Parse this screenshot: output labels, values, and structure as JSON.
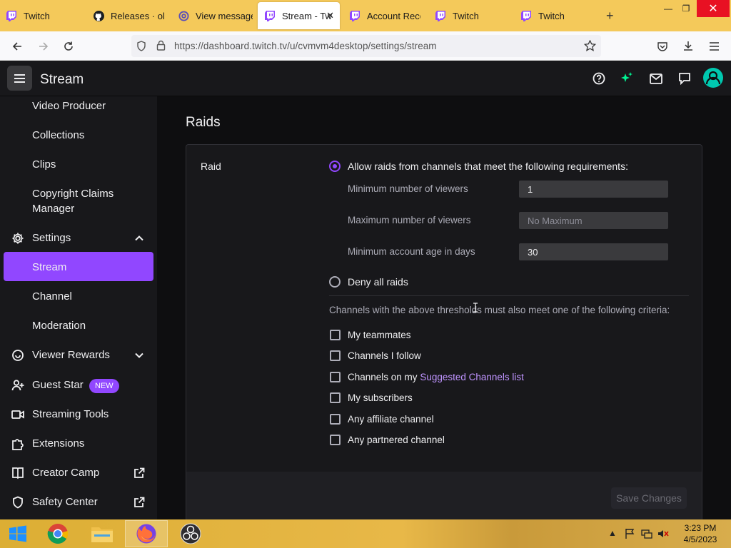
{
  "browser": {
    "tabs": [
      {
        "label": "Twitch",
        "icon": "twitch-icon"
      },
      {
        "label": "Releases · obsp",
        "icon": "github-icon"
      },
      {
        "label": "View message",
        "icon": "at-sign-icon"
      },
      {
        "label": "Stream - Tw",
        "icon": "twitch-icon",
        "active": true
      },
      {
        "label": "Account Reco",
        "icon": "twitch-icon"
      },
      {
        "label": "Twitch",
        "icon": "twitch-icon"
      },
      {
        "label": "Twitch",
        "icon": "twitch-icon"
      }
    ],
    "new_tab": "+",
    "url": "https://dashboard.twitch.tv/u/cvmvm4desktop/settings/stream"
  },
  "header": {
    "title": "Stream"
  },
  "sidebar": {
    "items": [
      {
        "label": "Video Producer"
      },
      {
        "label": "Collections"
      },
      {
        "label": "Clips"
      },
      {
        "label": "Copyright Claims Manager",
        "line1": "Copyright Claims",
        "line2": "Manager"
      },
      {
        "label": "Settings",
        "icon": "gear-icon"
      },
      {
        "label": "Stream",
        "active": true
      },
      {
        "label": "Channel"
      },
      {
        "label": "Moderation"
      },
      {
        "label": "Viewer Rewards",
        "icon": "rewards-icon"
      },
      {
        "label": "Guest Star",
        "icon": "add-person-icon",
        "badge": "NEW"
      },
      {
        "label": "Streaming Tools",
        "icon": "camera-icon"
      },
      {
        "label": "Extensions",
        "icon": "puzzle-icon"
      },
      {
        "label": "Creator Camp",
        "icon": "book-icon"
      },
      {
        "label": "Safety Center",
        "icon": "shield-icon"
      }
    ]
  },
  "raids": {
    "section_title": "Raids",
    "row_label": "Raid",
    "allow_label": "Allow raids from channels that meet the following requirements:",
    "min_viewers_label": "Minimum number of viewers",
    "min_viewers_value": "1",
    "max_viewers_label": "Maximum number of viewers",
    "max_viewers_placeholder": "No Maximum",
    "min_age_label": "Minimum account age in days",
    "min_age_value": "30",
    "deny_label": "Deny all raids",
    "criteria_text": "Channels with the above thresholds must also meet one of the following criteria:",
    "checkboxes": [
      {
        "label": "My teammates",
        "checked": false
      },
      {
        "label": "Channels I follow",
        "checked": false
      },
      {
        "label": "Channels on my ",
        "link": "Suggested Channels list",
        "checked": false
      },
      {
        "label": "My subscribers",
        "checked": false
      },
      {
        "label": "Any affiliate channel",
        "checked": false
      },
      {
        "label": "Any partnered channel",
        "checked": false
      }
    ],
    "save_label": "Save Changes"
  },
  "taskbar": {
    "time": "3:23 PM",
    "date": "4/5/2023"
  },
  "colors": {
    "accent": "#9147ff",
    "link": "#bf94ff",
    "tabstrip": "#f4c95a"
  }
}
